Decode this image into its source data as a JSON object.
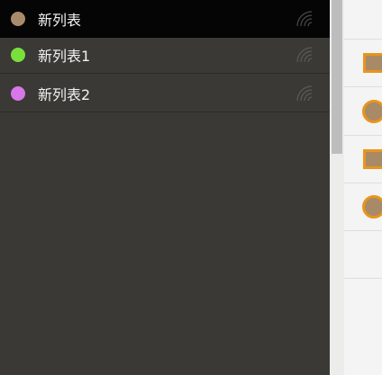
{
  "sidebar": {
    "lists": [
      {
        "label": "新列表",
        "color": "#a98b6b",
        "selected": true,
        "icon": "rss-icon"
      },
      {
        "label": "新列表1",
        "color": "#79e03b",
        "selected": false,
        "icon": "rss-icon"
      },
      {
        "label": "新列表2",
        "color": "#d777e8",
        "selected": false,
        "icon": "rss-icon"
      }
    ]
  },
  "main": {
    "task_markers": [
      {
        "shape": "square",
        "fill": "#a88a66",
        "border": "#e8951d"
      },
      {
        "shape": "circle",
        "fill": "#a88a66",
        "border": "#e8951d"
      },
      {
        "shape": "square",
        "fill": "#a88a66",
        "border": "#e8951d"
      },
      {
        "shape": "circle",
        "fill": "#a88a66",
        "border": "#e8951d"
      }
    ]
  }
}
